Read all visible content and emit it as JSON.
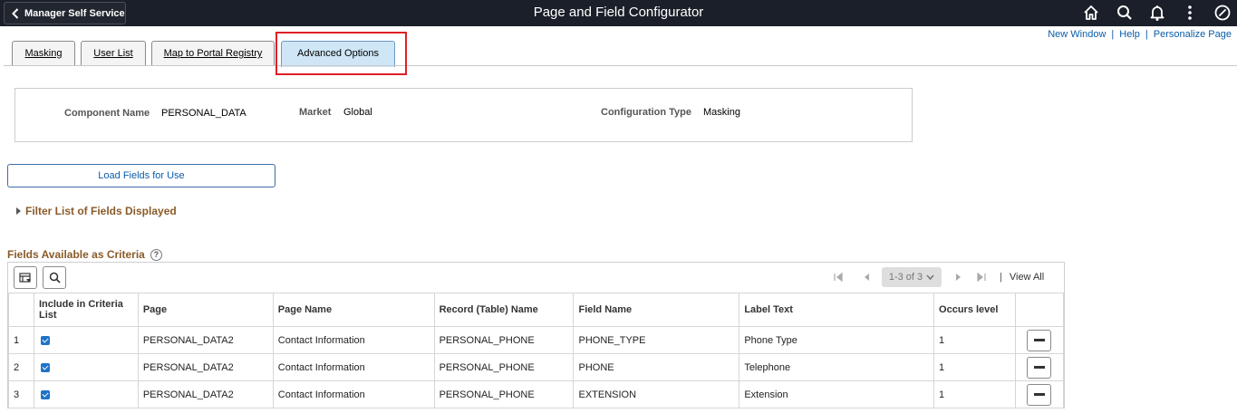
{
  "header": {
    "back_label": "Manager Self Service",
    "title": "Page and Field Configurator",
    "icons": [
      "home-icon",
      "search-icon",
      "bell-icon",
      "actions-menu-icon",
      "navbar-icon"
    ]
  },
  "toplinks": {
    "new_window": "New Window",
    "help": "Help",
    "personalize": "Personalize Page",
    "separator": "|"
  },
  "tabs": [
    {
      "label": "Masking",
      "active": false
    },
    {
      "label": "User List",
      "active": false
    },
    {
      "label": "Map to Portal Registry",
      "active": false
    },
    {
      "label": "Advanced Options",
      "active": true
    }
  ],
  "info": {
    "component_label": "Component Name",
    "component_value": "PERSONAL_DATA",
    "market_label": "Market",
    "market_value": "Global",
    "config_label": "Configuration Type",
    "config_value": "Masking"
  },
  "load_button": "Load Fields for Use",
  "filter_label": "Filter List of Fields Displayed",
  "grid": {
    "title": "Fields Available as Criteria",
    "help_glyph": "?",
    "pager_text": "1-3 of 3",
    "view_all": "View All",
    "pager_separator": "|",
    "columns": [
      "Include in Criteria List",
      "Page",
      "Page Name",
      "Record (Table) Name",
      "Field Name",
      "Label Text",
      "Occurs level"
    ],
    "rows": [
      {
        "num": "1",
        "page": "PERSONAL_DATA2",
        "page_name": "Contact Information",
        "record": "PERSONAL_PHONE",
        "field": "PHONE_TYPE",
        "label": "Phone Type",
        "occurs": "1"
      },
      {
        "num": "2",
        "page": "PERSONAL_DATA2",
        "page_name": "Contact Information",
        "record": "PERSONAL_PHONE",
        "field": "PHONE",
        "label": "Telephone",
        "occurs": "1"
      },
      {
        "num": "3",
        "page": "PERSONAL_DATA2",
        "page_name": "Contact Information",
        "record": "PERSONAL_PHONE",
        "field": "EXTENSION",
        "label": "Extension",
        "occurs": "1"
      }
    ]
  },
  "colors": {
    "header_bg": "#1b1f29",
    "link": "#0b5da8",
    "section_title": "#8a5a28",
    "active_tab": "#cfe6f7",
    "highlight": "#e01f26",
    "checkbox": "#1f73c8"
  }
}
